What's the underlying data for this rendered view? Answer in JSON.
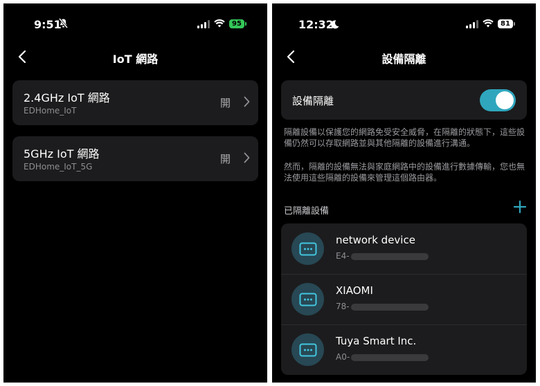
{
  "left": {
    "status": {
      "time": "9:51",
      "battery": "95"
    },
    "nav": {
      "title": "IoT 網路"
    },
    "networks": [
      {
        "title": "2.4GHz IoT 網路",
        "ssid": "EDHome_IoT",
        "status": "開"
      },
      {
        "title": "5GHz IoT 網路",
        "ssid": "EDHome_IoT_5G",
        "status": "開"
      }
    ]
  },
  "right": {
    "status": {
      "time": "12:32",
      "battery": "81"
    },
    "nav": {
      "title": "設備隔離"
    },
    "toggle": {
      "label": "設備隔離",
      "on": true
    },
    "description": [
      "隔離設備以保護您的網路免受安全威脅，在隔離的狀態下，這些設備仍然可以存取網路並與其他隔離的設備進行溝通。",
      "然而，隔離的設備無法與家庭網路中的設備進行數據傳輸，您也無法使用這些隔離的設備來管理這個路由器。"
    ],
    "section": {
      "label": "已隔離設備"
    },
    "devices": [
      {
        "name": "network device",
        "mac_prefix": "E4-"
      },
      {
        "name": "XIAOMI",
        "mac_prefix": "78-"
      },
      {
        "name": "Tuya Smart Inc.",
        "mac_prefix": "A0-"
      }
    ]
  },
  "colors": {
    "accent": "#2fa6bd",
    "battery_left": "#34c759",
    "card": "#1c1c1e"
  },
  "icons": [
    "bell-slash-icon",
    "moon-icon",
    "cellular-signal-icon",
    "wifi-icon",
    "battery-icon",
    "back-chevron-icon",
    "chevron-right-icon",
    "plus-icon",
    "device-icon"
  ]
}
